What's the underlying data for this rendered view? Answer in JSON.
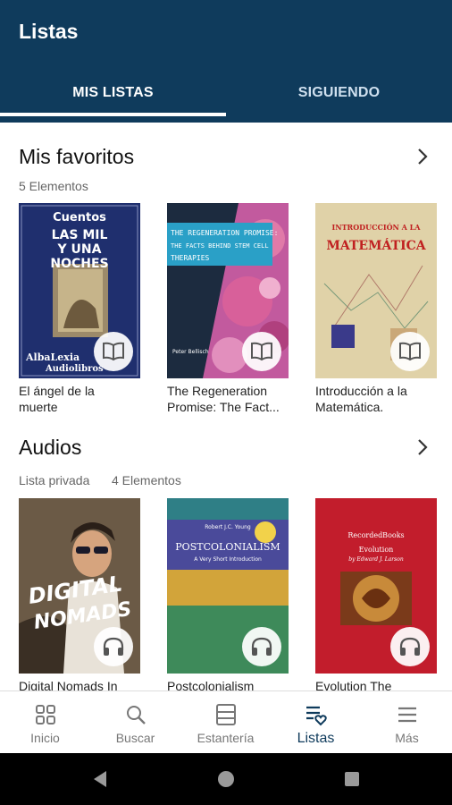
{
  "app": {
    "title": "Listas"
  },
  "tabs": [
    {
      "label": "MIS LISTAS",
      "active": true
    },
    {
      "label": "SIGUIENDO",
      "active": false
    }
  ],
  "sections": [
    {
      "title": "Mis favoritos",
      "subtitle": "5 Elementos",
      "books": [
        {
          "caption_lines": [
            "El ángel de la",
            "muerte"
          ],
          "badge_icon": "book-open-icon",
          "cover_text": [
            "Cuentos",
            "LAS MIL",
            "Y UNA",
            "NOCHES",
            "AlbaLexia",
            "Audiolibros"
          ]
        },
        {
          "caption_lines": [
            "The Regeneration",
            "Promise: The Fact..."
          ],
          "badge_icon": "book-open-icon",
          "cover_text": [
            "THE REGENERATION PROMISE:",
            "THE FACTS BEHIND STEM CELL",
            "THERAPIES",
            "Peter Bellisch"
          ]
        },
        {
          "caption_lines": [
            "Introducción a la",
            "Matemática."
          ],
          "badge_icon": "book-open-icon",
          "cover_text": [
            "INTRODUCCIÓN A LA",
            "MATEMÁTICA"
          ]
        }
      ]
    },
    {
      "title": "Audios",
      "subtitle_privacy": "Lista privada",
      "subtitle": "4 Elementos",
      "books": [
        {
          "caption_lines": [
            "Digital Nomads In"
          ],
          "badge_icon": "headphones-icon",
          "cover_text": [
            "DIGITAL",
            "NOMADS"
          ]
        },
        {
          "caption_lines": [
            "Postcolonialism"
          ],
          "badge_icon": "headphones-icon",
          "cover_text": [
            "Robert J.C. Young",
            "POSTCOLONIALISM",
            "A Very Short Introduction"
          ]
        },
        {
          "caption_lines": [
            "Evolution The"
          ],
          "badge_icon": "headphones-icon",
          "cover_text": [
            "RecordedBooks",
            "Evolution",
            "by Edward J. Larson"
          ]
        }
      ]
    }
  ],
  "bottom_nav": [
    {
      "label": "Inicio",
      "icon": "grid-icon",
      "active": false
    },
    {
      "label": "Buscar",
      "icon": "search-icon",
      "active": false
    },
    {
      "label": "Estantería",
      "icon": "shelf-icon",
      "active": false
    },
    {
      "label": "Listas",
      "icon": "list-heart-icon",
      "active": true
    },
    {
      "label": "Más",
      "icon": "menu-icon",
      "active": false
    }
  ],
  "colors": {
    "primary": "#0f3b5c",
    "active_nav": "#0f3b5c",
    "inactive_nav": "#777777"
  }
}
